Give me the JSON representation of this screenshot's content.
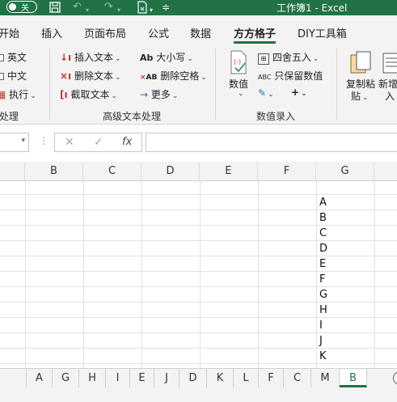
{
  "titlebar": {
    "autosave_label": "关",
    "window_title": "工作簿1  -  Excel",
    "icons": [
      "toggle-autosave",
      "save-icon",
      "undo-icon",
      "redo-icon",
      "touch-mode-icon",
      "customize-qat-icon"
    ]
  },
  "ribbon_tabs": [
    {
      "label": "开始"
    },
    {
      "label": "插入"
    },
    {
      "label": "页面布局"
    },
    {
      "label": "公式"
    },
    {
      "label": "数据"
    },
    {
      "label": "方方格子",
      "active": true
    },
    {
      "label": "DIY工具箱"
    }
  ],
  "ribbon": {
    "group_left": {
      "items": [
        "英文",
        "中文",
        "执行"
      ],
      "label": "处理"
    },
    "group_text": {
      "items": [
        "插入文本",
        "删除文本",
        "截取文本",
        "大小写",
        "删除空格",
        "更多"
      ],
      "label": "高级文本处理"
    },
    "group_number": {
      "value_button": "数值",
      "items": [
        "四舍五入",
        "只保留数值"
      ],
      "plus_label": "+",
      "label": "数值录入"
    },
    "group_right": {
      "copy_paste": [
        "复制粘",
        "贴"
      ],
      "add_insert": [
        "新增",
        "入"
      ]
    }
  },
  "formula_bar": {
    "cancel": "✕",
    "enter": "✓",
    "fx": "fx",
    "value": ""
  },
  "columns": [
    "B",
    "C",
    "D",
    "E",
    "F",
    "G"
  ],
  "cells_G": [
    "A",
    "B",
    "C",
    "D",
    "E",
    "F",
    "G",
    "H",
    "I",
    "J",
    "K"
  ],
  "sheet_tabs": [
    {
      "label": "A"
    },
    {
      "label": "G"
    },
    {
      "label": "H"
    },
    {
      "label": "I"
    },
    {
      "label": "E"
    },
    {
      "label": "J"
    },
    {
      "label": "D"
    },
    {
      "label": "K"
    },
    {
      "label": "L"
    },
    {
      "label": "F"
    },
    {
      "label": "C"
    },
    {
      "label": "M"
    },
    {
      "label": "B",
      "active": true
    }
  ],
  "colors": {
    "brand": "#217346",
    "ribbon_bg": "#f3f3f3"
  }
}
